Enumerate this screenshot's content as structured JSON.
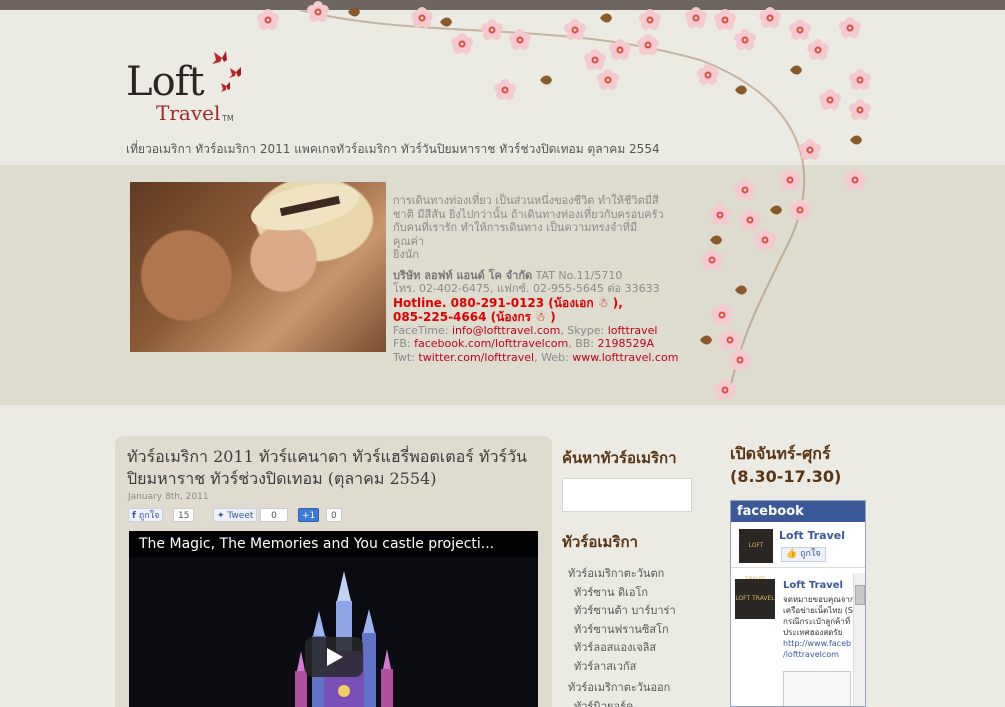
{
  "header": {
    "logo_main": "Loft",
    "logo_sub": "Travel",
    "logo_tm": "TM",
    "tagline": "เที่ยวอเมริกา ทัวร์อเมริกา 2011 แพคเกจทัวร์อเมริกา ทัวร์วันปิยมหาราช ทัวร์ช่วงปิดเทอม ตุลาคม 2554"
  },
  "feature": {
    "intro_line1": "การเดินทางท่องเที่ยว เป็นส่วนหนึ่งของชีวิต ทำให้ชีวิตมีสี",
    "intro_line2": "ชาติ มีสีสัน ยิ่งไปกว่านั้น ถ้าเดินทางท่องเที่ยวกับครอบครัว",
    "intro_line3": "กับคนที่เรารัก ทำให้การเดินทาง เป็นความทรงจำที่มีคุณค่า",
    "intro_line4": "ยิ่งนัก",
    "company": "บริษัท ลอฟท์ แอนด์ โค จำกัด",
    "tat": " TAT No.11/5710",
    "phone": "โทร. 02-402-6475, แฟกซ์. 02-955-5645 ต่อ 33633",
    "hotline1": "Hotline. 080-291-0123 (น้องเอก ☃ ),",
    "hotline2": "085-225-4664 (น้องกร ☃ )",
    "facetime_label": "FaceTime: ",
    "facetime_value": "info@lofttravel.com",
    "skype_label": ", Skype: ",
    "skype_value": "lofttravel",
    "fb_label": "FB: ",
    "fb_value": "facebook.com/lofttravelcom",
    "bb_label": ", BB: ",
    "bb_value": "2198529A",
    "twt_label": "Twt: ",
    "twt_value": "twitter.com/lofttravel",
    "web_label": ", Web: ",
    "web_value": "www.lofttravel.com"
  },
  "post": {
    "title": "ทัวร์อเมริกา 2011 ทัวร์แคนาดา ทัวร์แฮรี่พอตเตอร์ ทัวร์วันปิยมหาราช ทัวร์ช่วงปิดเทอม (ตุลาคม 2554)",
    "date": "January 8th, 2011",
    "like_label": "ถูกใจ",
    "like_count": "15",
    "tweet_label": "Tweet",
    "tweet_count": "0",
    "plusone_label": "+1",
    "plusone_count": "0",
    "video_title": "The Magic, The Memories and You castle projecti..."
  },
  "sidebar": {
    "search_heading": "ค้นหาทัวร์อเมริกา",
    "list_heading": "ทัวร์อเมริกา",
    "items": [
      {
        "label": "ทัวร์อเมริกาตะวันตก",
        "level": "cat"
      },
      {
        "label": "ทัวร์ซาน ดิเอโก",
        "level": "sub"
      },
      {
        "label": "ทัวร์ซานต้า บาร์บาร่า",
        "level": "sub"
      },
      {
        "label": "ทัวร์ซานฟรานซิสโก",
        "level": "sub"
      },
      {
        "label": "ทัวร์ลอสแองเจลิส",
        "level": "sub"
      },
      {
        "label": "ทัวร์ลาสเวกัส",
        "level": "sub"
      },
      {
        "label": "ทัวร์อเมริกาตะวันออก",
        "level": "cat"
      },
      {
        "label": "ทัวร์นิวยอร์ค",
        "level": "sub"
      }
    ]
  },
  "hours": {
    "line1": "เปิดจันทร์-ศุกร์",
    "line2": "(8.30-17.30)"
  },
  "facebook": {
    "bar": "facebook",
    "page_name": "Loft Travel",
    "like_label": "ถูกใจ",
    "logo_text": "LOFT TRAVEL",
    "post_name": "Loft Travel",
    "post_line1": "จดหมายขอบคุณจาก",
    "post_line2": "เครือข่ายเน็ตไทย (S",
    "post_line3": "กรณีกระเป๋าลูกค้าที่",
    "post_line4": "ประเทศฮองสดรัย",
    "post_link1": "http://www.faceb",
    "post_link2": "/lofttravelcom"
  }
}
